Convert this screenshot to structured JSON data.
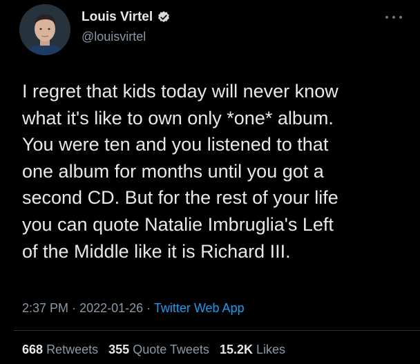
{
  "author": {
    "display_name": "Louis Virtel",
    "handle": "@louisvirtel",
    "verified_icon": "verified-badge-icon",
    "avatar_icon": "profile-photo"
  },
  "tweet": {
    "lines": [
      "I regret that kids today will never know",
      "what it's like to own only *one* album.",
      "You were ten and you listened to that",
      "one album for months until you got a",
      "second CD. But for the rest of your life",
      "you can quote Natalie Imbruglia's Left",
      "of the Middle like it is Richard III."
    ],
    "time": "2:37 PM",
    "separator": "·",
    "date": "2022-01-26",
    "source": "Twitter Web App"
  },
  "stats": {
    "retweets_count": "668",
    "retweets_label": "Retweets",
    "quotes_count": "355",
    "quotes_label": "Quote Tweets",
    "likes_count": "15.2K",
    "likes_label": "Likes"
  },
  "colors": {
    "background": "#000000",
    "text": "#e7e9ea",
    "secondary": "#8b98a5",
    "link": "#1d9bf0",
    "verified": "#d9d9d9"
  }
}
